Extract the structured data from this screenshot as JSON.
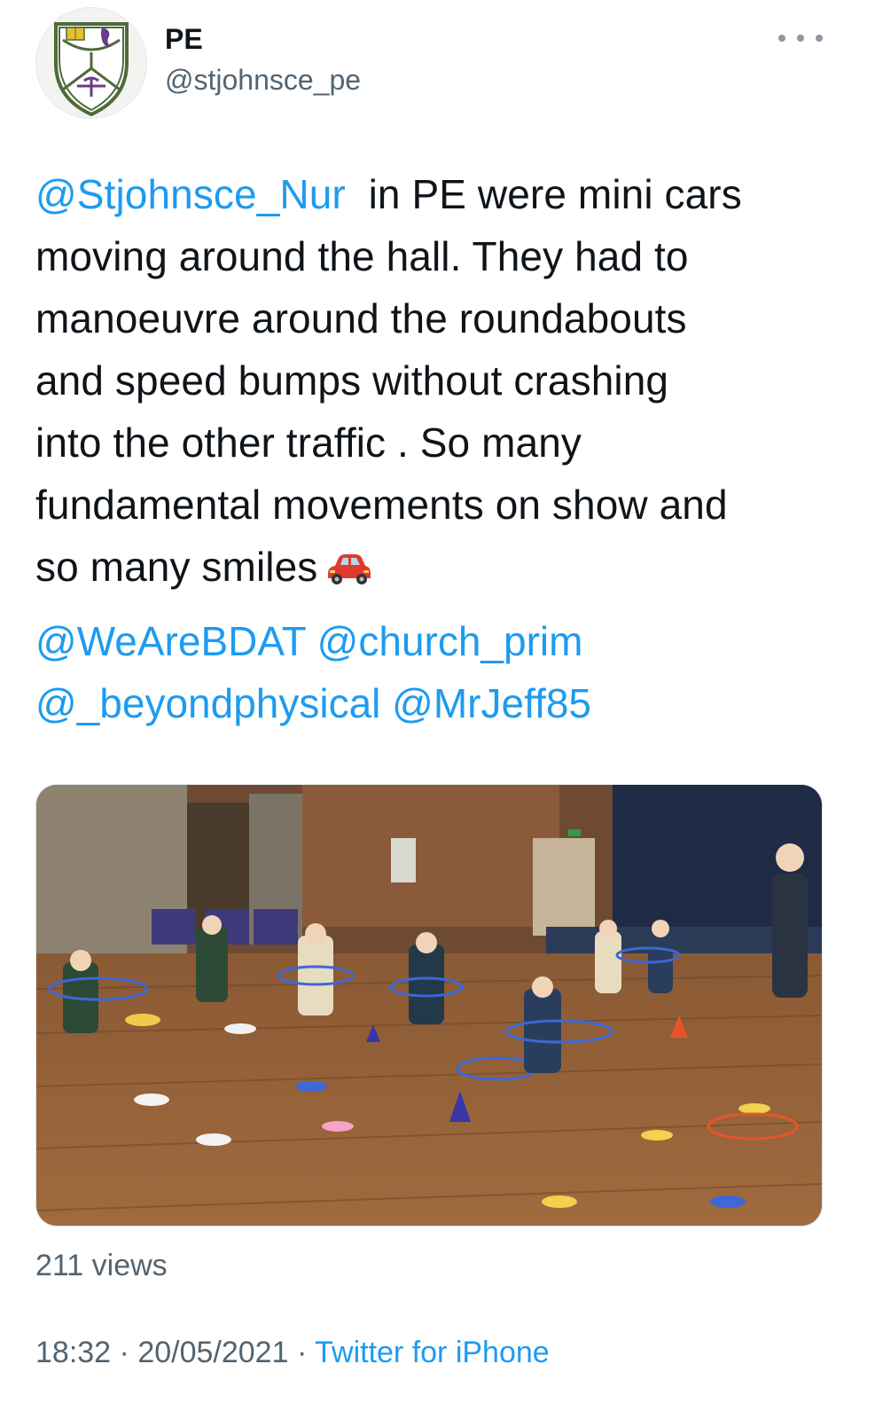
{
  "profile": {
    "display_name": "PE",
    "handle": "@stjohnsce_pe"
  },
  "tweet": {
    "mention_lead": "@Stjohnsce_Nur",
    "lines": [
      "  in PE were mini cars",
      "moving around the hall. They had to",
      "manoeuvre around the roundabouts",
      "and speed bumps without crashing",
      "into the other traffic . So many",
      "fundamental movements on show and",
      "so many smiles"
    ],
    "emoji": "car-emoji",
    "mentions_line1": [
      "@WeAreBDAT",
      "@church_prim"
    ],
    "mentions_line2": [
      "@_beyondphysical",
      "@MrJeff85"
    ]
  },
  "media": {
    "icon": "video-thumbnail"
  },
  "stats": {
    "views": "211 views"
  },
  "meta": {
    "time": "18:32",
    "date": "20/05/2021",
    "separator": "·",
    "source": "Twitter for iPhone"
  },
  "colors": {
    "link": "#1d9bf0",
    "secondary_text": "#536471",
    "primary_text": "#0f1419"
  }
}
